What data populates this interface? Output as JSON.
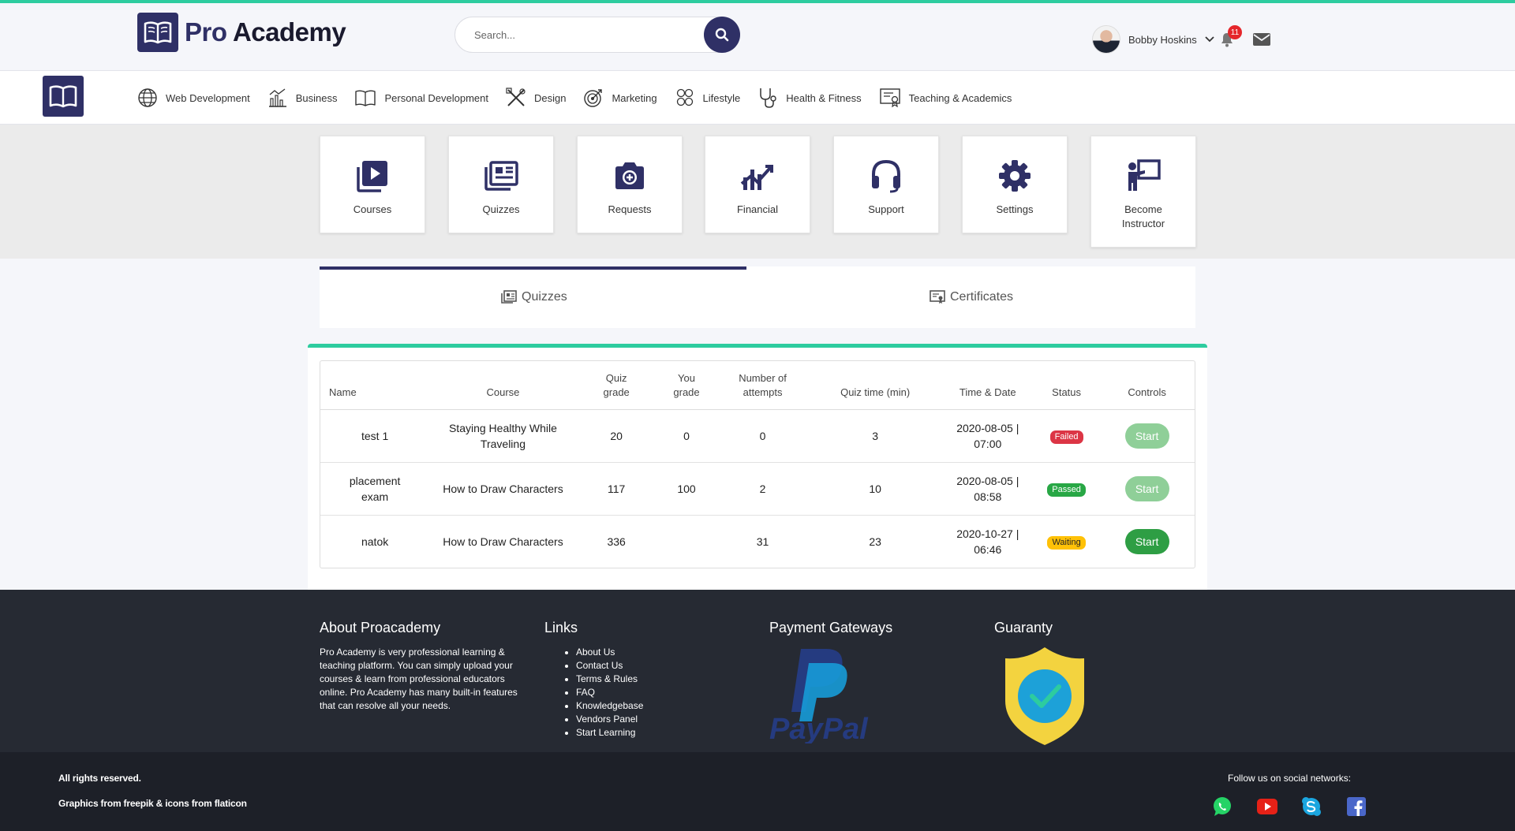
{
  "header": {
    "brand": "Pro Academy",
    "brand_first": "Pro",
    "brand_second": "Academy",
    "search_placeholder": "Search...",
    "user_name": "Bobby Hoskins",
    "notification_count": "11"
  },
  "categories": [
    {
      "label": "Web Development",
      "icon": "globe-icon"
    },
    {
      "label": "Business",
      "icon": "chart-icon"
    },
    {
      "label": "Personal Development",
      "icon": "book-icon"
    },
    {
      "label": "Design",
      "icon": "design-tools-icon"
    },
    {
      "label": "Marketing",
      "icon": "target-icon"
    },
    {
      "label": "Lifestyle",
      "icon": "lifestyle-icon"
    },
    {
      "label": "Health & Fitness",
      "icon": "stethoscope-icon"
    },
    {
      "label": "Teaching & Academics",
      "icon": "certificate-icon"
    }
  ],
  "tiles": [
    {
      "label": "Courses",
      "icon": "video-library-icon"
    },
    {
      "label": "Quizzes",
      "icon": "quiz-icon"
    },
    {
      "label": "Requests",
      "icon": "camera-plus-icon"
    },
    {
      "label": "Financial",
      "icon": "growth-chart-icon"
    },
    {
      "label": "Support",
      "icon": "headset-icon"
    },
    {
      "label": "Settings",
      "icon": "gear-icon"
    },
    {
      "label": "Become Instructor",
      "icon": "instructor-icon"
    }
  ],
  "tabs": [
    {
      "label": "Quizzes",
      "active": true
    },
    {
      "label": "Certificates",
      "active": false
    }
  ],
  "table": {
    "headers": {
      "name": "Name",
      "course": "Course",
      "quiz_grade": "Quiz grade",
      "you_grade": "You grade",
      "attempts": "Number of attempts",
      "quiz_time": "Quiz time (min)",
      "time_date": "Time & Date",
      "status": "Status",
      "controls": "Controls"
    },
    "rows": [
      {
        "name": "test 1",
        "course": "Staying Healthy While Traveling",
        "quiz_grade": "20",
        "you_grade": "0",
        "attempts": "0",
        "quiz_time": "3",
        "date": "2020-08-05 |",
        "time": "07:00",
        "status": "Failed",
        "action": "Start"
      },
      {
        "name": "placement exam",
        "course": "How to Draw Characters",
        "quiz_grade": "117",
        "you_grade": "100",
        "attempts": "2",
        "quiz_time": "10",
        "date": "2020-08-05 |",
        "time": "08:58",
        "status": "Passed",
        "action": "Start"
      },
      {
        "name": "natok",
        "course": "How to Draw Characters",
        "quiz_grade": "336",
        "you_grade": "",
        "attempts": "31",
        "quiz_time": "23",
        "date": "2020-10-27 |",
        "time": "06:46",
        "status": "Waiting",
        "action": "Start"
      }
    ]
  },
  "footer": {
    "about_title": "About Proacademy",
    "about_text": "Pro Academy is very professional learning & teaching platform. You can simply upload your courses & learn from professional educators online. Pro Academy has many built-in features that can resolve all your needs.",
    "links_title": "Links",
    "links": [
      "About Us",
      "Contact Us",
      "Terms & Rules",
      "FAQ",
      "Knowledgebase",
      "Vendors Panel",
      "Start Learning"
    ],
    "payment_title": "Payment Gateways",
    "paypal_text": "PayPal",
    "guaranty_title": "Guaranty",
    "rights": "All rights reserved.",
    "credits": "Graphics from freepik & icons from flaticon",
    "follow": "Follow us on social networks:"
  },
  "colors": {
    "brand": "#2f3066",
    "accent": "#2dcc9f",
    "failed": "#dc3545",
    "passed": "#28a745",
    "waiting": "#ffc107"
  }
}
